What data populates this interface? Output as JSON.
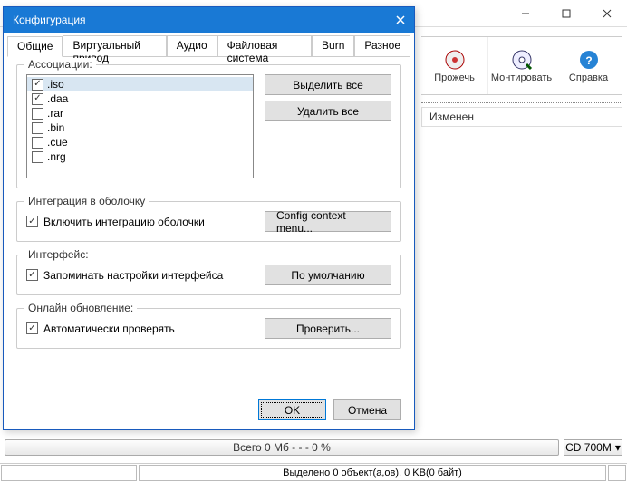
{
  "mainWindow": {
    "toolbar": [
      {
        "label": "Прожечь",
        "icon": "burn-icon"
      },
      {
        "label": "Монтировать",
        "icon": "mount-icon"
      },
      {
        "label": "Справка",
        "icon": "help-icon"
      }
    ],
    "listHeader": "Изменен"
  },
  "dialog": {
    "title": "Конфигурация",
    "tabs": [
      "Общие",
      "Виртуальный привод",
      "Аудио",
      "Файловая система",
      "Burn",
      "Разное"
    ],
    "activeTab": 0,
    "associations": {
      "title": "Ассоциации:",
      "items": [
        {
          "ext": ".iso",
          "checked": true,
          "selected": true
        },
        {
          "ext": ".daa",
          "checked": true,
          "selected": false
        },
        {
          "ext": ".rar",
          "checked": false,
          "selected": false
        },
        {
          "ext": ".bin",
          "checked": false,
          "selected": false
        },
        {
          "ext": ".cue",
          "checked": false,
          "selected": false
        },
        {
          "ext": ".nrg",
          "checked": false,
          "selected": false
        }
      ],
      "selectAll": "Выделить все",
      "deleteAll": "Удалить все"
    },
    "shell": {
      "title": "Интеграция в оболочку",
      "enableLabel": "Включить интеграцию оболочки",
      "enableChecked": true,
      "configBtn": "Config context menu..."
    },
    "interface": {
      "title": "Интерфейс:",
      "rememberLabel": "Запоминать настройки интерфейса",
      "rememberChecked": true,
      "defaultBtn": "По умолчанию"
    },
    "update": {
      "title": "Онлайн обновление:",
      "autoLabel": "Автоматически проверять",
      "autoChecked": true,
      "checkBtn": "Проверить..."
    },
    "buttons": {
      "ok": "OK",
      "cancel": "Отмена"
    }
  },
  "bottom": {
    "progressText": "Всего  0 Мб  - - -  0 %",
    "discLabel": "CD 700M",
    "statusSelection": "Выделено 0 объект(а,ов), 0 KB(0 байт)"
  }
}
